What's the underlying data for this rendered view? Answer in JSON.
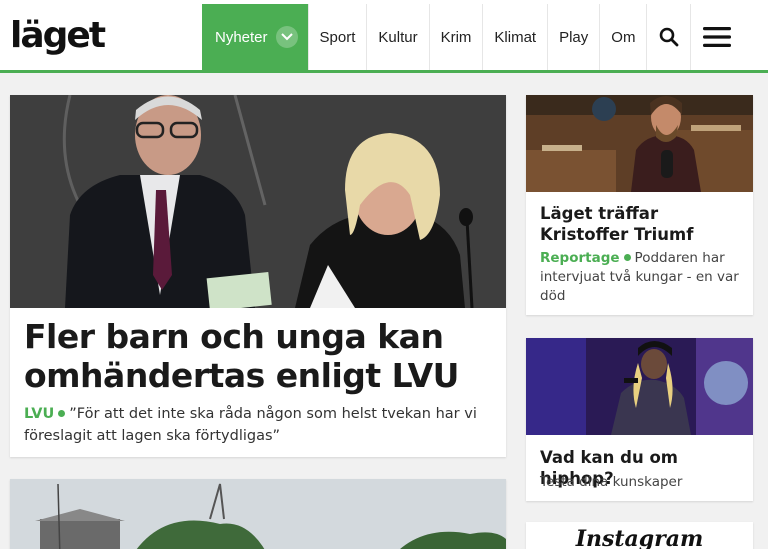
{
  "header": {
    "logo_text": "läget",
    "nav": [
      {
        "label": "Nyheter"
      },
      {
        "label": "Sport"
      },
      {
        "label": "Kultur"
      },
      {
        "label": "Krim"
      },
      {
        "label": "Klimat"
      },
      {
        "label": "Play"
      },
      {
        "label": "Om"
      }
    ],
    "accent_color": "#4bae53"
  },
  "main_article": {
    "title": "Fler barn och unga kan omhändertas enligt LVU",
    "tag": "LVU",
    "lead": "”För att det inte ska råda någon som helst tvekan har vi föreslagit att lagen ska förtydligas”"
  },
  "side_articles": [
    {
      "title": "Läget träffar Kristoffer Triumf",
      "tag": "Reportage",
      "lead": "Poddaren har intervjuat två kungar - en var död"
    },
    {
      "title": "Vad kan du om hiphop?",
      "lead": "Testa dina kunskaper"
    }
  ],
  "instagram": {
    "label": "Instagram"
  }
}
